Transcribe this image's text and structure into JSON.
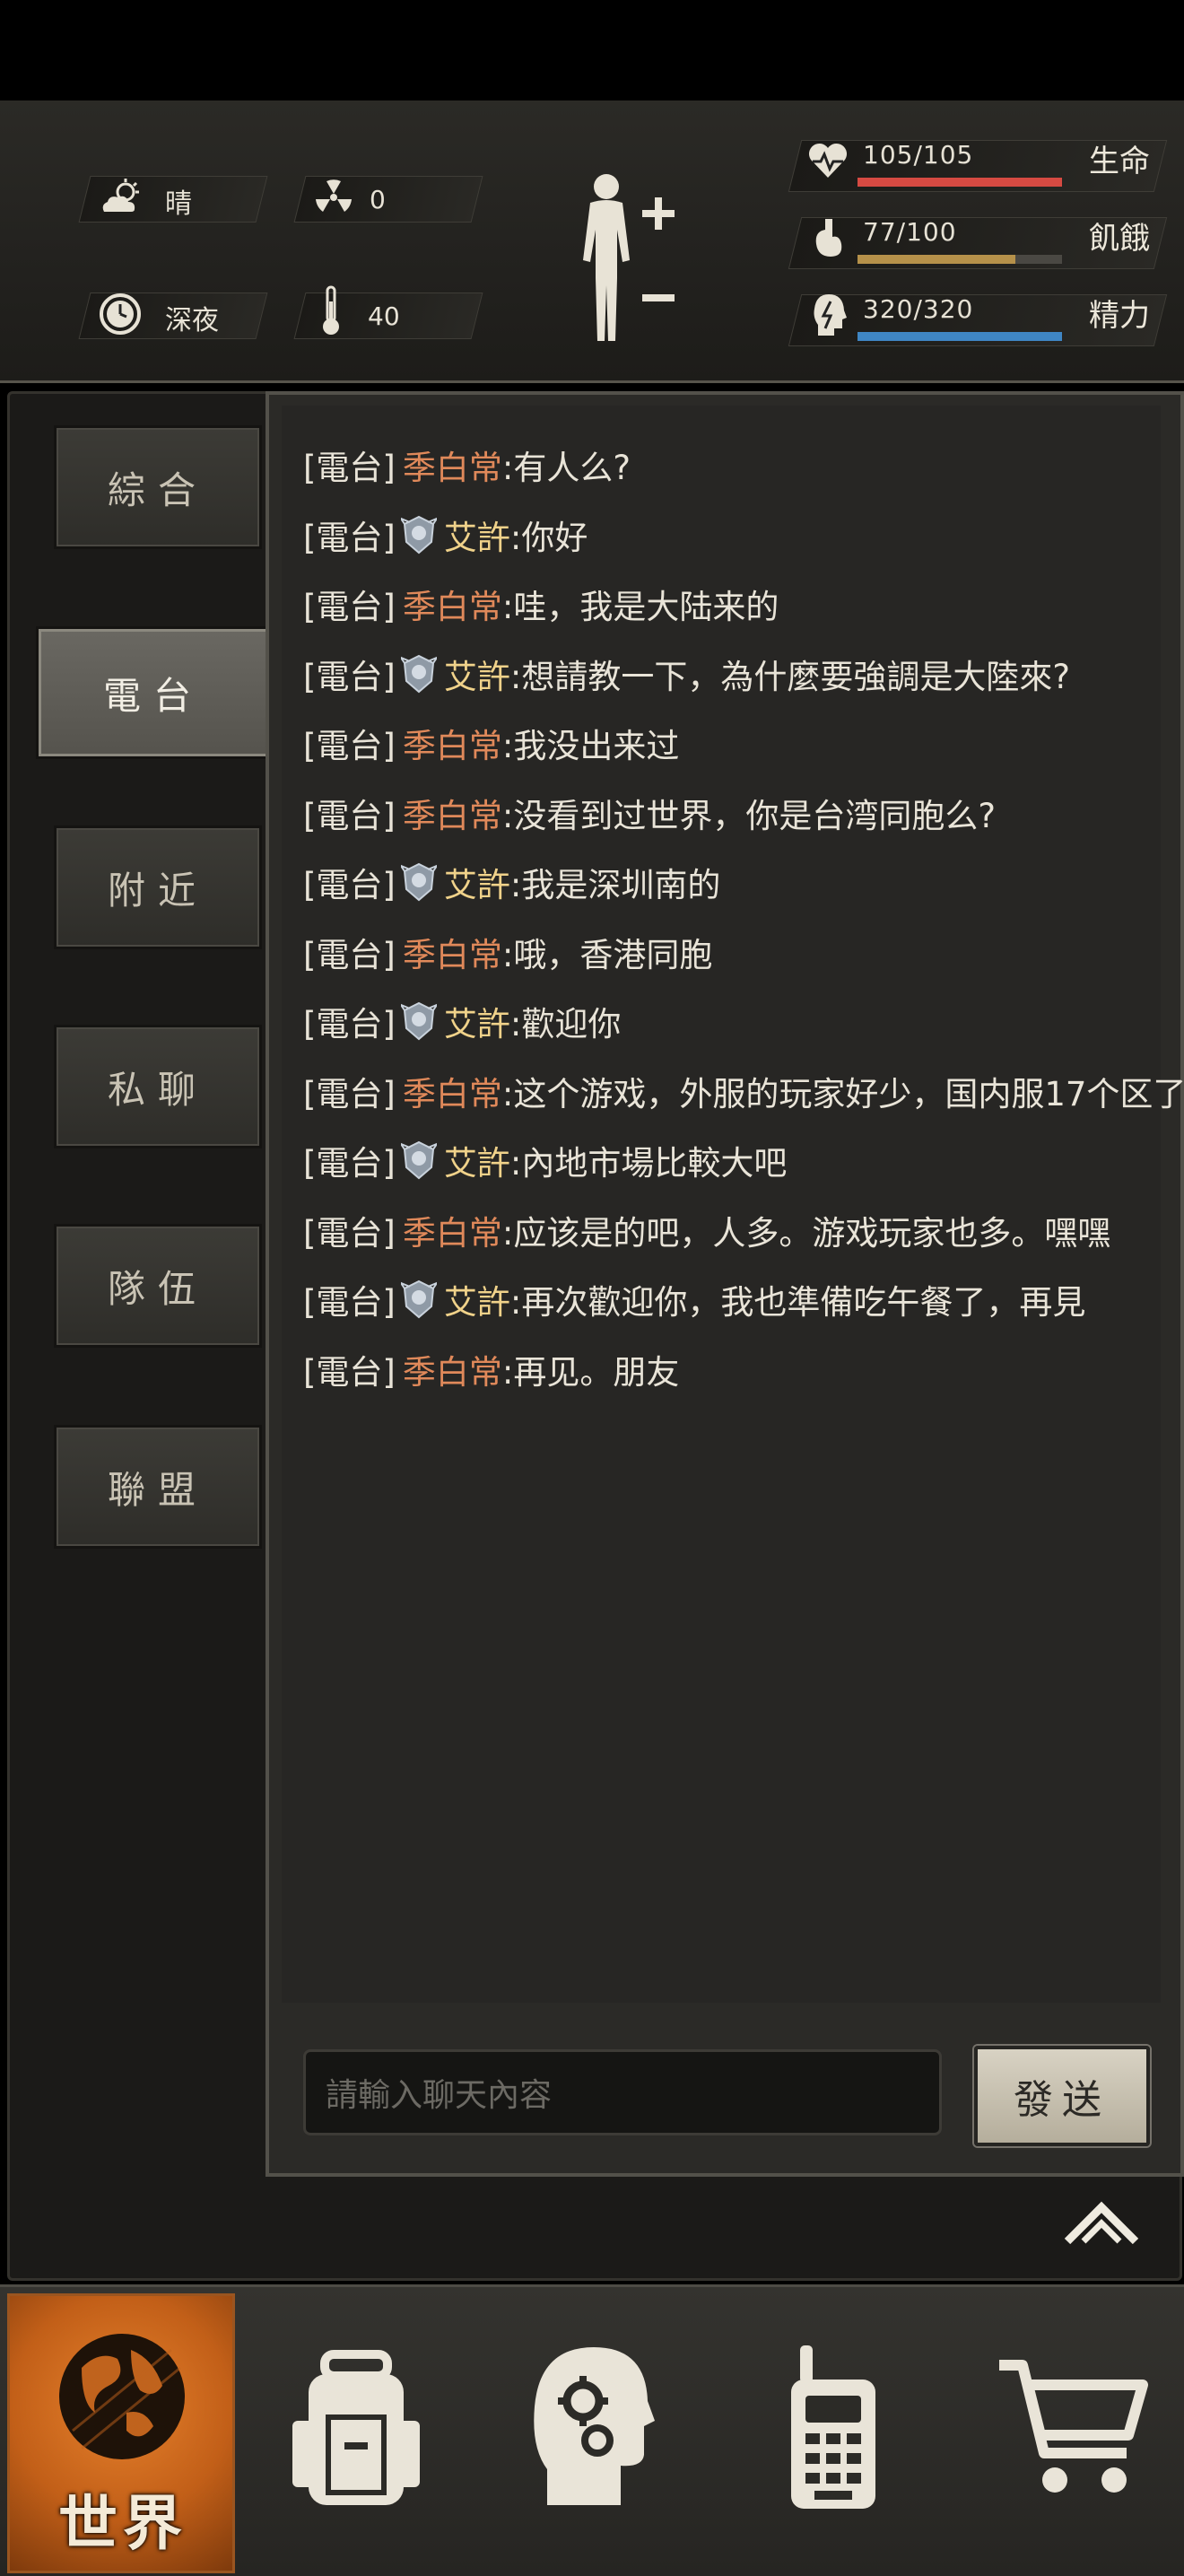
{
  "hud": {
    "weather": "晴",
    "radiation": "0",
    "time_of_day": "深夜",
    "temperature": "40",
    "stats": [
      {
        "label": "生命",
        "value": "105/105",
        "fraction": 1.0,
        "color": "#d64a42"
      },
      {
        "label": "飢餓",
        "value": "77/100",
        "fraction": 0.77,
        "color": "#b6914a"
      },
      {
        "label": "精力",
        "value": "320/320",
        "fraction": 1.0,
        "color": "#3f86c4"
      }
    ]
  },
  "tabs": [
    "綜合",
    "電台",
    "附近",
    "私聊",
    "隊伍",
    "聯盟"
  ],
  "active_tab": "電台",
  "messages": [
    {
      "channel": "[電台]",
      "name": "季白常",
      "text": ":有人么?",
      "badge": false
    },
    {
      "channel": "[電台]",
      "name": "艾許",
      "text": ":你好",
      "badge": true
    },
    {
      "channel": "[電台]",
      "name": "季白常",
      "text": ":哇，我是大陆来的",
      "badge": false
    },
    {
      "channel": "[電台]",
      "name": "艾許",
      "text": ":想請教一下，為什麼要強調是大陸來?",
      "badge": true
    },
    {
      "channel": "[電台]",
      "name": "季白常",
      "text": ":我没出来过",
      "badge": false
    },
    {
      "channel": "[電台]",
      "name": "季白常",
      "text": ":没看到过世界，你是台湾同胞么?",
      "badge": false
    },
    {
      "channel": "[電台]",
      "name": "艾許",
      "text": ":我是深圳南的",
      "badge": true
    },
    {
      "channel": "[電台]",
      "name": "季白常",
      "text": ":哦，香港同胞",
      "badge": false
    },
    {
      "channel": "[電台]",
      "name": "艾許",
      "text": ":歡迎你",
      "badge": true
    },
    {
      "channel": "[電台]",
      "name": "季白常",
      "text": ":这个游戏，外服的玩家好少，国内服17个区了",
      "badge": false
    },
    {
      "channel": "[電台]",
      "name": "艾許",
      "text": ":內地市場比較大吧",
      "badge": true
    },
    {
      "channel": "[電台]",
      "name": "季白常",
      "text": ":应该是的吧，人多。游戏玩家也多。嘿嘿",
      "badge": false
    },
    {
      "channel": "[電台]",
      "name": "艾許",
      "text": ":再次歡迎你，我也準備吃午餐了，再見",
      "badge": true
    },
    {
      "channel": "[電台]",
      "name": "季白常",
      "text": ":再见。朋友",
      "badge": false
    }
  ],
  "input": {
    "placeholder": "請輸入聊天內容"
  },
  "send_label": "發送",
  "nav": {
    "active_label": "世界",
    "items": [
      "world",
      "backpack",
      "skills",
      "radio",
      "shop"
    ]
  }
}
